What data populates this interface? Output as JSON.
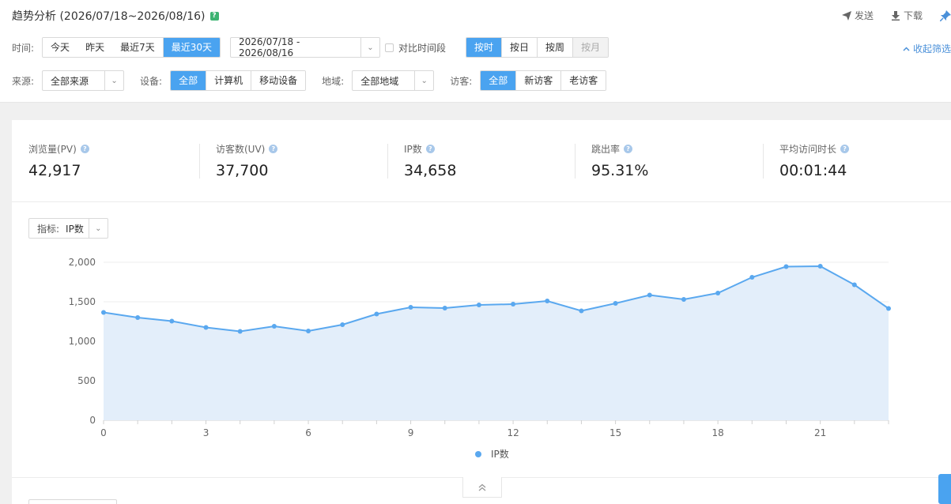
{
  "header": {
    "title": "趋势分析 (2026/07/18~2026/08/16)",
    "help_mark": "?",
    "send_label": "发送",
    "download_label": "下载",
    "collapse_filter_label": "收起筛选"
  },
  "filters": {
    "time_label": "时间:",
    "time_options": [
      "今天",
      "昨天",
      "最近7天",
      "最近30天"
    ],
    "time_active": "最近30天",
    "date_range": "2026/07/18 - 2026/08/16",
    "compare_label": "对比时间段",
    "granularity": [
      "按时",
      "按日",
      "按周",
      "按月"
    ],
    "granularity_active": "按时",
    "granularity_disabled": "按月",
    "source_label": "来源:",
    "source_value": "全部来源",
    "device_label": "设备:",
    "device_options": [
      "全部",
      "计算机",
      "移动设备"
    ],
    "device_active": "全部",
    "region_label": "地域:",
    "region_value": "全部地域",
    "visitor_label": "访客:",
    "visitor_options": [
      "全部",
      "新访客",
      "老访客"
    ],
    "visitor_active": "全部"
  },
  "kpis": [
    {
      "label": "浏览量(PV)",
      "value": "42,917"
    },
    {
      "label": "访客数(UV)",
      "value": "37,700"
    },
    {
      "label": "IP数",
      "value": "34,658"
    },
    {
      "label": "跳出率",
      "value": "95.31%"
    },
    {
      "label": "平均访问时长",
      "value": "00:01:44"
    }
  ],
  "metric_selector": {
    "label": "指标:",
    "value": "IP数"
  },
  "colors": {
    "accent": "#4aa3f0",
    "area_fill": "#e3eefa",
    "line": "#5aa8ef",
    "active_btn": "#4aa3f0"
  },
  "chart_data": {
    "type": "area",
    "x": [
      0,
      1,
      2,
      3,
      4,
      5,
      6,
      7,
      8,
      9,
      10,
      11,
      12,
      13,
      14,
      15,
      16,
      17,
      18,
      19,
      20,
      21,
      22,
      23
    ],
    "xticks": [
      0,
      3,
      6,
      9,
      12,
      15,
      18,
      21
    ],
    "yticks": [
      0,
      500,
      1000,
      1500,
      2000
    ],
    "ylim": [
      0,
      2000
    ],
    "series": [
      {
        "name": "IP数",
        "values": [
          1365,
          1300,
          1255,
          1175,
          1125,
          1190,
          1130,
          1210,
          1345,
          1430,
          1420,
          1460,
          1470,
          1510,
          1385,
          1480,
          1585,
          1530,
          1610,
          1810,
          1945,
          1950,
          1715,
          1415
        ]
      }
    ]
  }
}
